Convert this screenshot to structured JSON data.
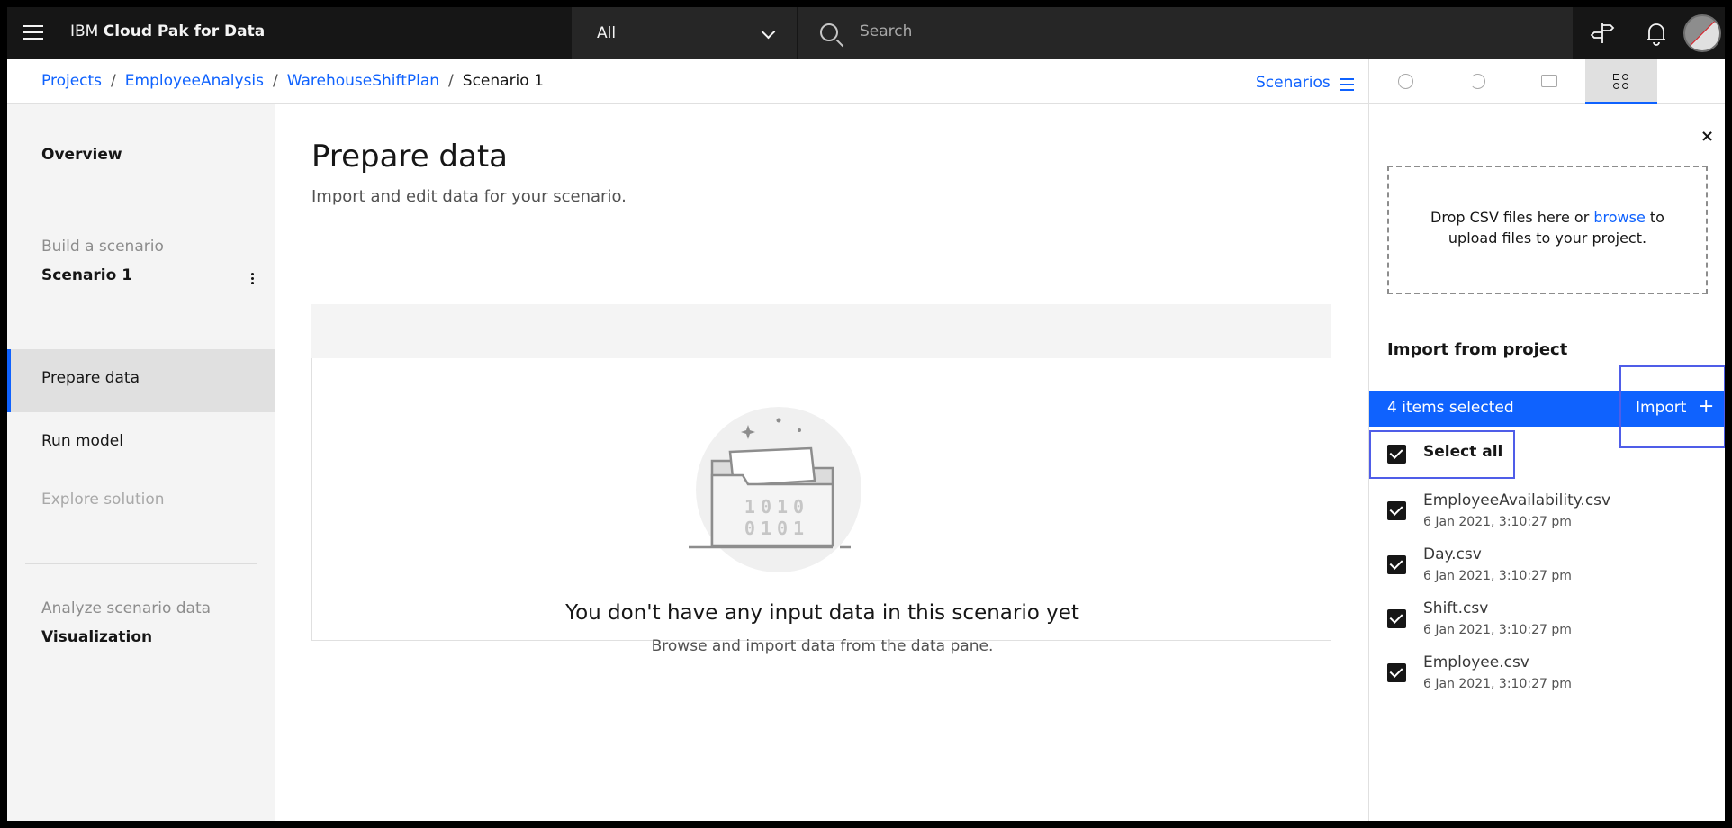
{
  "header": {
    "brand_prefix": "IBM",
    "brand_name": "Cloud Pak for Data",
    "scope": "All",
    "search_placeholder": "Search"
  },
  "breadcrumb": {
    "items": [
      "Projects",
      "EmployeeAnalysis",
      "WarehouseShiftPlan"
    ],
    "current": "Scenario 1",
    "scenarios_link": "Scenarios"
  },
  "sidebar": {
    "overview": "Overview",
    "build_label": "Build a scenario",
    "scenario_name": "Scenario 1",
    "prepare_data": "Prepare data",
    "run_model": "Run model",
    "explore_solution": "Explore solution",
    "analyze_label": "Analyze scenario data",
    "visualization": "Visualization"
  },
  "main": {
    "title": "Prepare data",
    "subtitle": "Import and edit data for your scenario.",
    "empty_title": "You don't have any input data in this scenario yet",
    "empty_subtitle": "Browse and import data from the data pane.",
    "illo_bits_1": "1010",
    "illo_bits_2": "0101"
  },
  "data_panel": {
    "dropzone_text_1": "Drop CSV files here or",
    "dropzone_link": "browse",
    "dropzone_text_2": "to",
    "dropzone_text_3": "upload files to your project.",
    "import_heading": "Import from project",
    "selected_count": "4 items selected",
    "import_button": "Import",
    "select_all": "Select all",
    "files": [
      {
        "name": "EmployeeAvailability.csv",
        "date": "6 Jan 2021, 3:10:27 pm"
      },
      {
        "name": "Day.csv",
        "date": "6 Jan 2021, 3:10:27 pm"
      },
      {
        "name": "Shift.csv",
        "date": "6 Jan 2021, 3:10:27 pm"
      },
      {
        "name": "Employee.csv",
        "date": "6 Jan 2021, 3:10:27 pm"
      }
    ]
  },
  "colors": {
    "accent": "#0f62fe",
    "header_bg": "#161616",
    "highlight_box": "#4f5de8"
  }
}
